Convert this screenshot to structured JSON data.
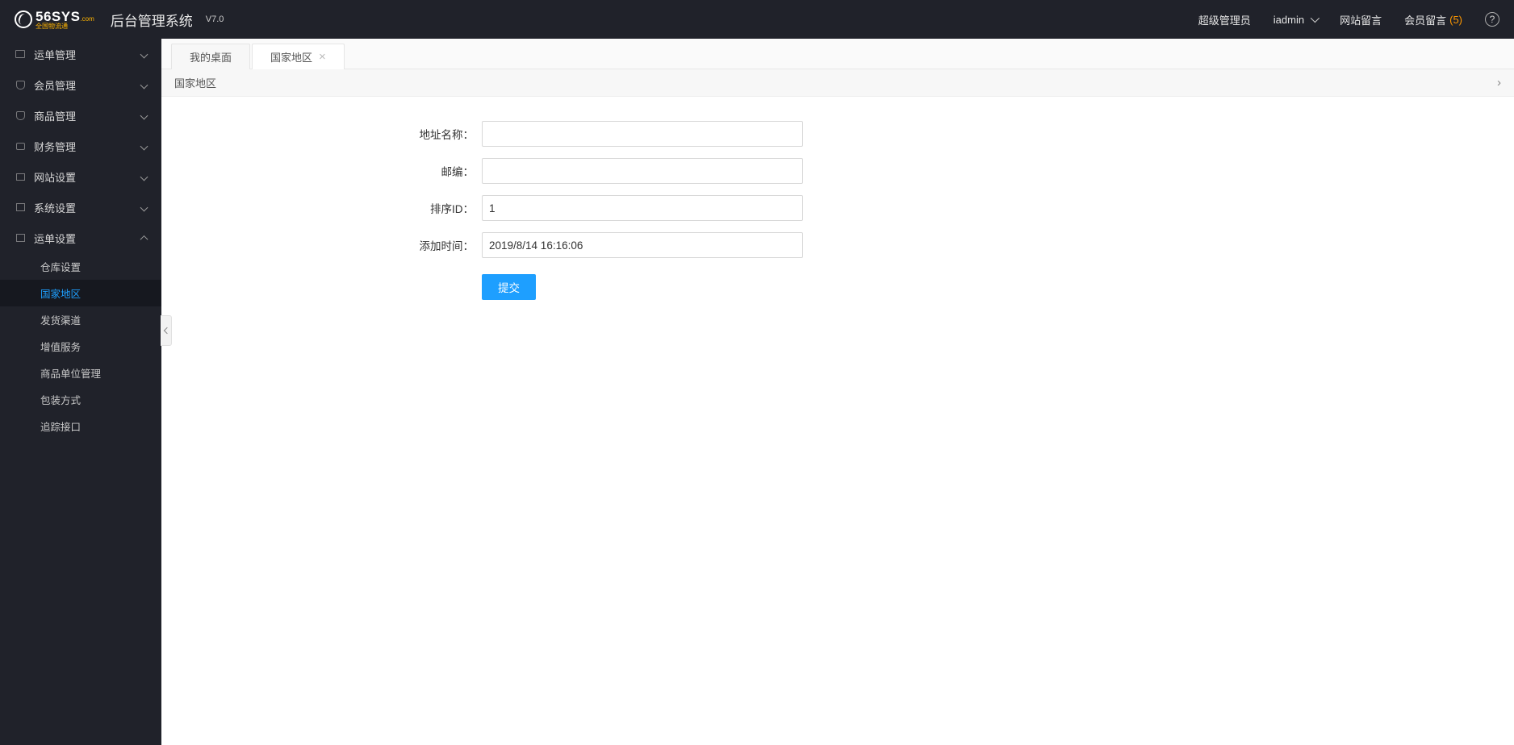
{
  "header": {
    "logo_main": "56SYS",
    "logo_dom": ".com",
    "logo_sub_top": "全国物流通",
    "app_title": "后台管理系统",
    "version": "V7.0",
    "role": "超级管理员",
    "user": "iadmin",
    "site_msg": "网站留言",
    "member_msg": "会员留言",
    "member_msg_count": "(5)"
  },
  "sidebar": {
    "items": [
      {
        "label": "运单管理",
        "expanded": false
      },
      {
        "label": "会员管理",
        "expanded": false
      },
      {
        "label": "商品管理",
        "expanded": false
      },
      {
        "label": "财务管理",
        "expanded": false
      },
      {
        "label": "网站设置",
        "expanded": false
      },
      {
        "label": "系统设置",
        "expanded": false
      },
      {
        "label": "运单设置",
        "expanded": true
      }
    ],
    "subitems": [
      {
        "label": "仓库设置",
        "active": false
      },
      {
        "label": "国家地区",
        "active": true
      },
      {
        "label": "发货渠道",
        "active": false
      },
      {
        "label": "增值服务",
        "active": false
      },
      {
        "label": "商品单位管理",
        "active": false
      },
      {
        "label": "包装方式",
        "active": false
      },
      {
        "label": "追踪接口",
        "active": false
      }
    ]
  },
  "tabs": [
    {
      "label": "我的桌面",
      "closable": false,
      "active": false
    },
    {
      "label": "国家地区",
      "closable": true,
      "active": true
    }
  ],
  "breadcrumb": {
    "title": "国家地区"
  },
  "form": {
    "addr_label": "地址名称：",
    "addr_value": "",
    "zip_label": "邮编：",
    "zip_value": "",
    "sort_label": "排序ID：",
    "sort_value": "1",
    "time_label": "添加时间：",
    "time_value": "2019/8/14 16:16:06",
    "submit": "提交"
  }
}
